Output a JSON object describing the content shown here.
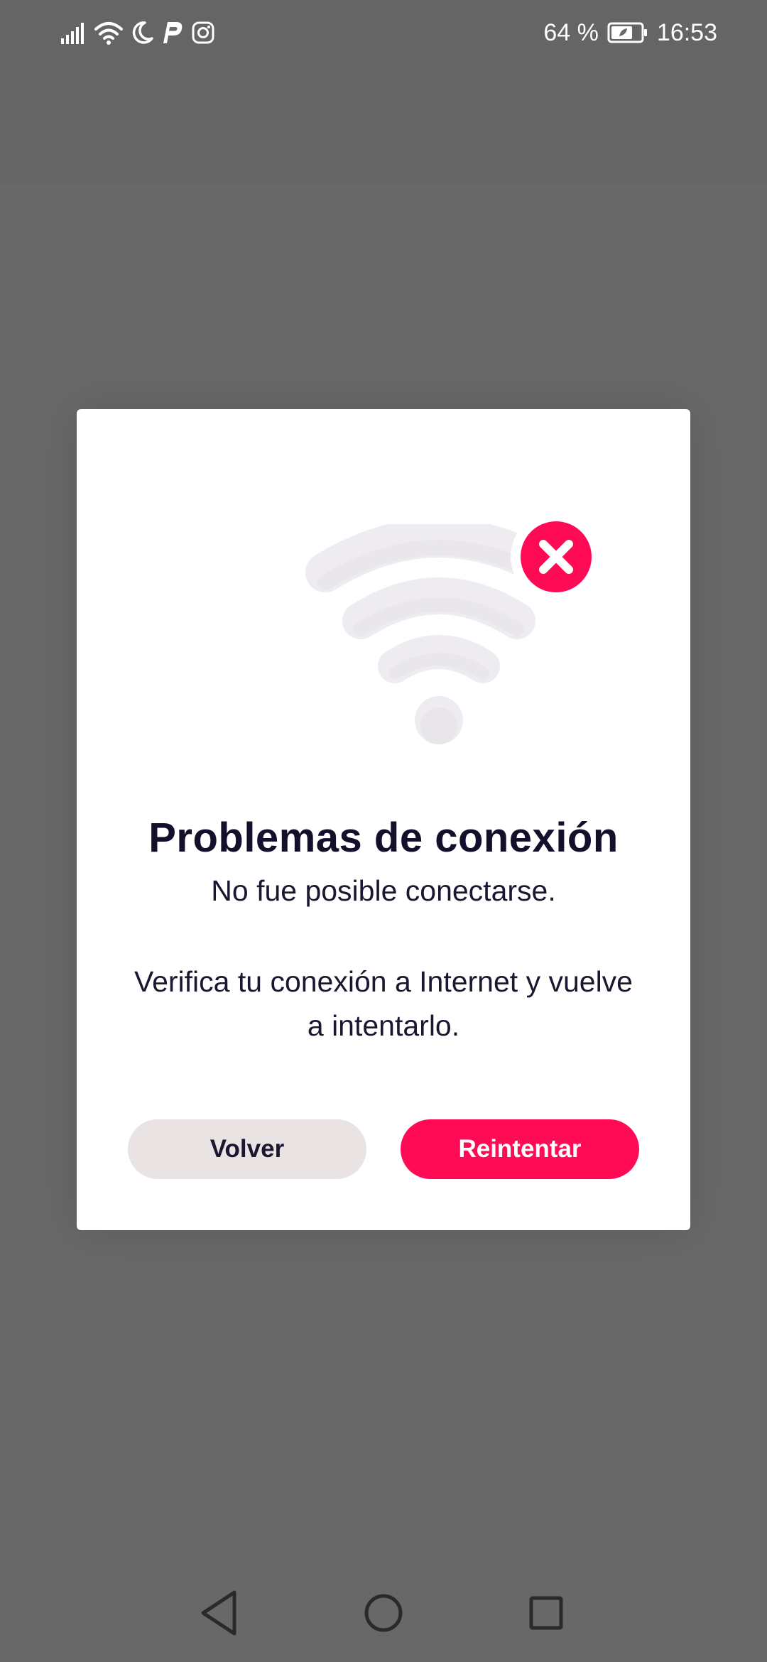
{
  "status_bar": {
    "battery_percent": "64 %",
    "time": "16:53"
  },
  "dialog": {
    "title": "Problemas de conexión",
    "subtitle": "No fue posible conectarse.",
    "message": "Verifica tu conexión a Internet y vuelve a intentarlo.",
    "back_label": "Volver",
    "retry_label": "Reintentar"
  },
  "colors": {
    "accent": "#ff0a55",
    "secondary_button": "#e9e3e3",
    "overlay": "#686868",
    "text_dark": "#140f2a"
  },
  "icons": {
    "status": [
      "signal-icon",
      "wifi-icon",
      "moon-icon",
      "parking-app-icon",
      "instagram-icon",
      "battery-icon"
    ],
    "illustration": [
      "wifi-off-illustration",
      "error-x-icon"
    ],
    "navigation": [
      "back-nav-icon",
      "home-nav-icon",
      "recents-nav-icon"
    ]
  }
}
